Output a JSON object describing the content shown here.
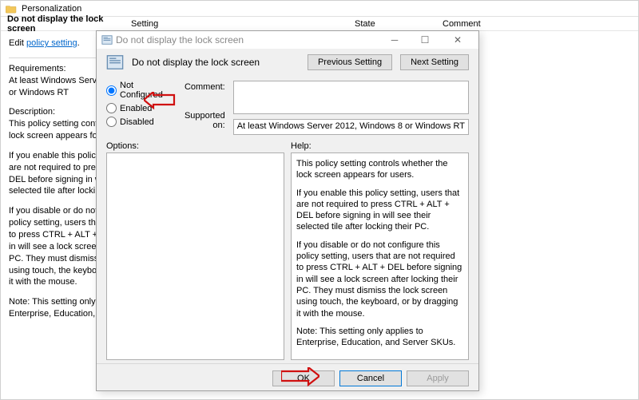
{
  "bg": {
    "category": "Personalization",
    "titleText": "Do not display the lock screen",
    "headers": {
      "setting": "Setting",
      "state": "State",
      "comment": "Comment"
    },
    "editLabel": "Edit",
    "editLink": "policy setting",
    "requirementsLabel": "Requirements:",
    "requirementsText": "At least Windows Server 2012, Windows 8 or Windows RT",
    "descriptionLabel": "Description:",
    "descriptionText": "This policy setting controls whether the lock screen appears for users.",
    "p1": "If you enable this policy setting, users that are not required to press CTRL + ALT + DEL before signing in will see their selected tile after locking their PC.",
    "p2": "If you disable or do not configure this policy setting, users that are not required to press CTRL + ALT + DEL before signing in will see a lock screen after locking their PC. They must dismiss the lock screen using touch, the keyboard, or by dragging it with the mouse.",
    "p3": "Note: This setting only applies to Enterprise, Education, and Server SKUs."
  },
  "dlg": {
    "winTitle": "Do not display the lock screen",
    "headTitle": "Do not display the lock screen",
    "btnPrev": "Previous Setting",
    "btnNext": "Next Setting",
    "radio": {
      "notConfigured": "Not Configured",
      "enabled": "Enabled",
      "disabled": "Disabled"
    },
    "labels": {
      "comment": "Comment:",
      "supported": "Supported on:",
      "options": "Options:",
      "help": "Help:"
    },
    "supportedText": "At least Windows Server 2012, Windows 8 or Windows RT",
    "help": {
      "h1": "This policy setting controls whether the lock screen appears for users.",
      "h2": "If you enable this policy setting, users that are not required to press CTRL + ALT + DEL before signing in will see their selected tile after locking their PC.",
      "h3": "If you disable or do not configure this policy setting, users that are not required to press CTRL + ALT + DEL before signing in will see a lock screen after locking their PC. They must dismiss the lock screen using touch, the keyboard, or by dragging it with the mouse.",
      "h4": "Note: This setting only applies to Enterprise, Education, and Server SKUs."
    },
    "footer": {
      "ok": "OK",
      "cancel": "Cancel",
      "apply": "Apply"
    }
  }
}
